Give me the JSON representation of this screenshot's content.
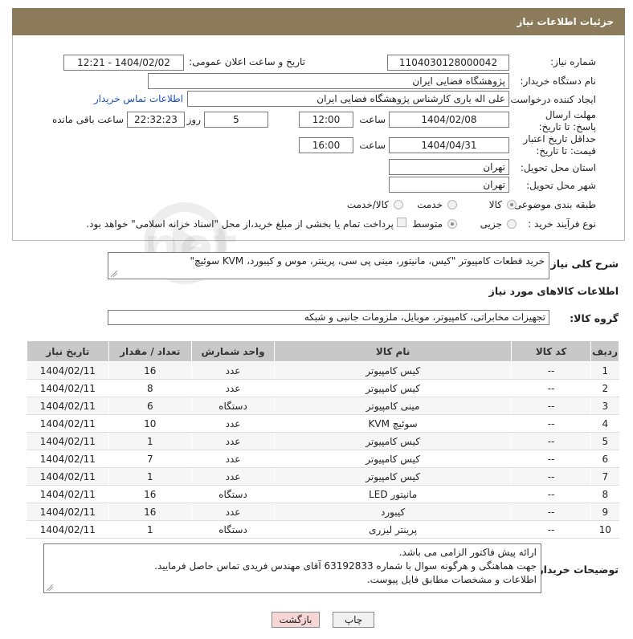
{
  "header": {
    "title": "جزئیات اطلاعات نیاز"
  },
  "form": {
    "need_number_label": "شماره نیاز:",
    "need_number": "1104030128000042",
    "announce_label": "تاریخ و ساعت اعلان عمومی:",
    "announce_value": "1404/02/02 - 12:21",
    "buyer_org_label": "نام دستگاه خریدار:",
    "buyer_org": "پژوهشگاه فضایی ایران",
    "creator_label": "ایجاد کننده درخواست:",
    "creator": "علی اله یاری کارشناس پژوهشگاه فضایی ایران",
    "contact_link": "اطلاعات تماس خریدار",
    "deadline_label": "مهلت ارسال پاسخ: تا تاریخ:",
    "deadline_date": "1404/02/08",
    "time_label": "ساعت",
    "deadline_time": "12:00",
    "days_value": "5",
    "days_label": "روز و",
    "remaining_time": "22:32:23",
    "remaining_label": "ساعت باقی مانده",
    "price_validity_label": "حداقل تاریخ اعتبار قیمت: تا تاریخ:",
    "price_validity_date": "1404/04/31",
    "price_validity_time": "16:00",
    "province_label": "استان محل تحویل:",
    "province": "تهران",
    "city_label": "شهر محل تحویل:",
    "city": "تهران",
    "category_label": "طبقه بندی موضوعی:",
    "category_options": [
      "کالا",
      "خدمت",
      "کالا/خدمت"
    ],
    "process_label": "نوع فرآیند خرید :",
    "process_options": [
      "جزیی",
      "متوسط"
    ],
    "payment_note": "پرداخت تمام یا بخشی از مبلغ خرید،از محل \"اسناد خزانه اسلامی\" خواهد بود."
  },
  "description": {
    "label": "شرح کلی نیاز:",
    "text": "خرید قطعات کامپیوتر \"کیس، مانیتور، مینی پی سی، پرینتر، موس و کیبورد، KVM سوئیچ\""
  },
  "goods": {
    "section_title": "اطلاعات کالاهای مورد نیاز",
    "group_label": "گروه کالا:",
    "group_value": "تجهیزات مخابراتی، کامپیوتر، موبایل، ملزومات جانبی و شبکه",
    "columns": [
      "ردیف",
      "کد کالا",
      "نام کالا",
      "واحد شمارش",
      "تعداد / مقدار",
      "تاریخ نیاز"
    ],
    "rows": [
      {
        "n": "1",
        "code": "--",
        "name": "کیس کامپیوتر",
        "unit": "عدد",
        "qty": "16",
        "date": "1404/02/11"
      },
      {
        "n": "2",
        "code": "--",
        "name": "کیس کامپیوتر",
        "unit": "عدد",
        "qty": "8",
        "date": "1404/02/11"
      },
      {
        "n": "3",
        "code": "--",
        "name": "مینی کامپیوتر",
        "unit": "دستگاه",
        "qty": "6",
        "date": "1404/02/11"
      },
      {
        "n": "4",
        "code": "--",
        "name": "سوئیچ KVM",
        "unit": "عدد",
        "qty": "10",
        "date": "1404/02/11"
      },
      {
        "n": "5",
        "code": "--",
        "name": "کیس کامپیوتر",
        "unit": "عدد",
        "qty": "1",
        "date": "1404/02/11"
      },
      {
        "n": "6",
        "code": "--",
        "name": "کیس کامپیوتر",
        "unit": "عدد",
        "qty": "7",
        "date": "1404/02/11"
      },
      {
        "n": "7",
        "code": "--",
        "name": "کیس کامپیوتر",
        "unit": "عدد",
        "qty": "1",
        "date": "1404/02/11"
      },
      {
        "n": "8",
        "code": "--",
        "name": "مانیتور LED",
        "unit": "دستگاه",
        "qty": "16",
        "date": "1404/02/11"
      },
      {
        "n": "9",
        "code": "--",
        "name": "کیبورد",
        "unit": "عدد",
        "qty": "16",
        "date": "1404/02/11"
      },
      {
        "n": "10",
        "code": "--",
        "name": "پرینتر لیزری",
        "unit": "دستگاه",
        "qty": "1",
        "date": "1404/02/11"
      }
    ]
  },
  "buyer_notes": {
    "label": "توضیحات خریدار:",
    "lines": [
      "ارائه پیش فاکتور الزامی می باشد.",
      "جهت هماهنگی و هرگونه سوال با شماره 63192833 آقای مهندس فریدی تماس حاصل فرمایید.",
      "اطلاعات و مشخصات مطابق فایل پیوست."
    ]
  },
  "buttons": {
    "print": "چاپ",
    "back": "بازگشت"
  },
  "watermark": {
    "text": "AriaTender.net"
  },
  "colors": {
    "titlebar": "#8c7b5a",
    "link": "#1a4fb5",
    "back_button": "#f7d6d6"
  }
}
